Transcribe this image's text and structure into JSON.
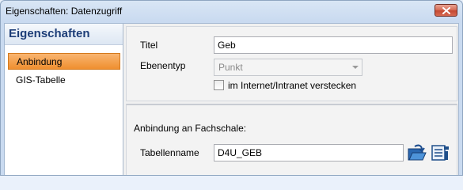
{
  "window": {
    "title": "Eigenschaften: Datenzugriff"
  },
  "nav": {
    "header": "Eigenschaften",
    "items": [
      {
        "label": "Anbindung",
        "selected": true
      },
      {
        "label": "GIS-Tabelle",
        "selected": false
      }
    ]
  },
  "general": {
    "title_label": "Titel",
    "title_value": "Geb",
    "layer_type_label": "Ebenentyp",
    "layer_type_value": "Punkt",
    "hide_checkbox_label": "im Internet/Intranet verstecken",
    "hide_checked": false
  },
  "connection": {
    "section_label": "Anbindung an Fachschale:",
    "table_name_label": "Tabellenname",
    "table_name_value": "D4U_GEB"
  },
  "colors": {
    "accent": "#1e3e78",
    "selected_item": "#ef8f2f"
  }
}
